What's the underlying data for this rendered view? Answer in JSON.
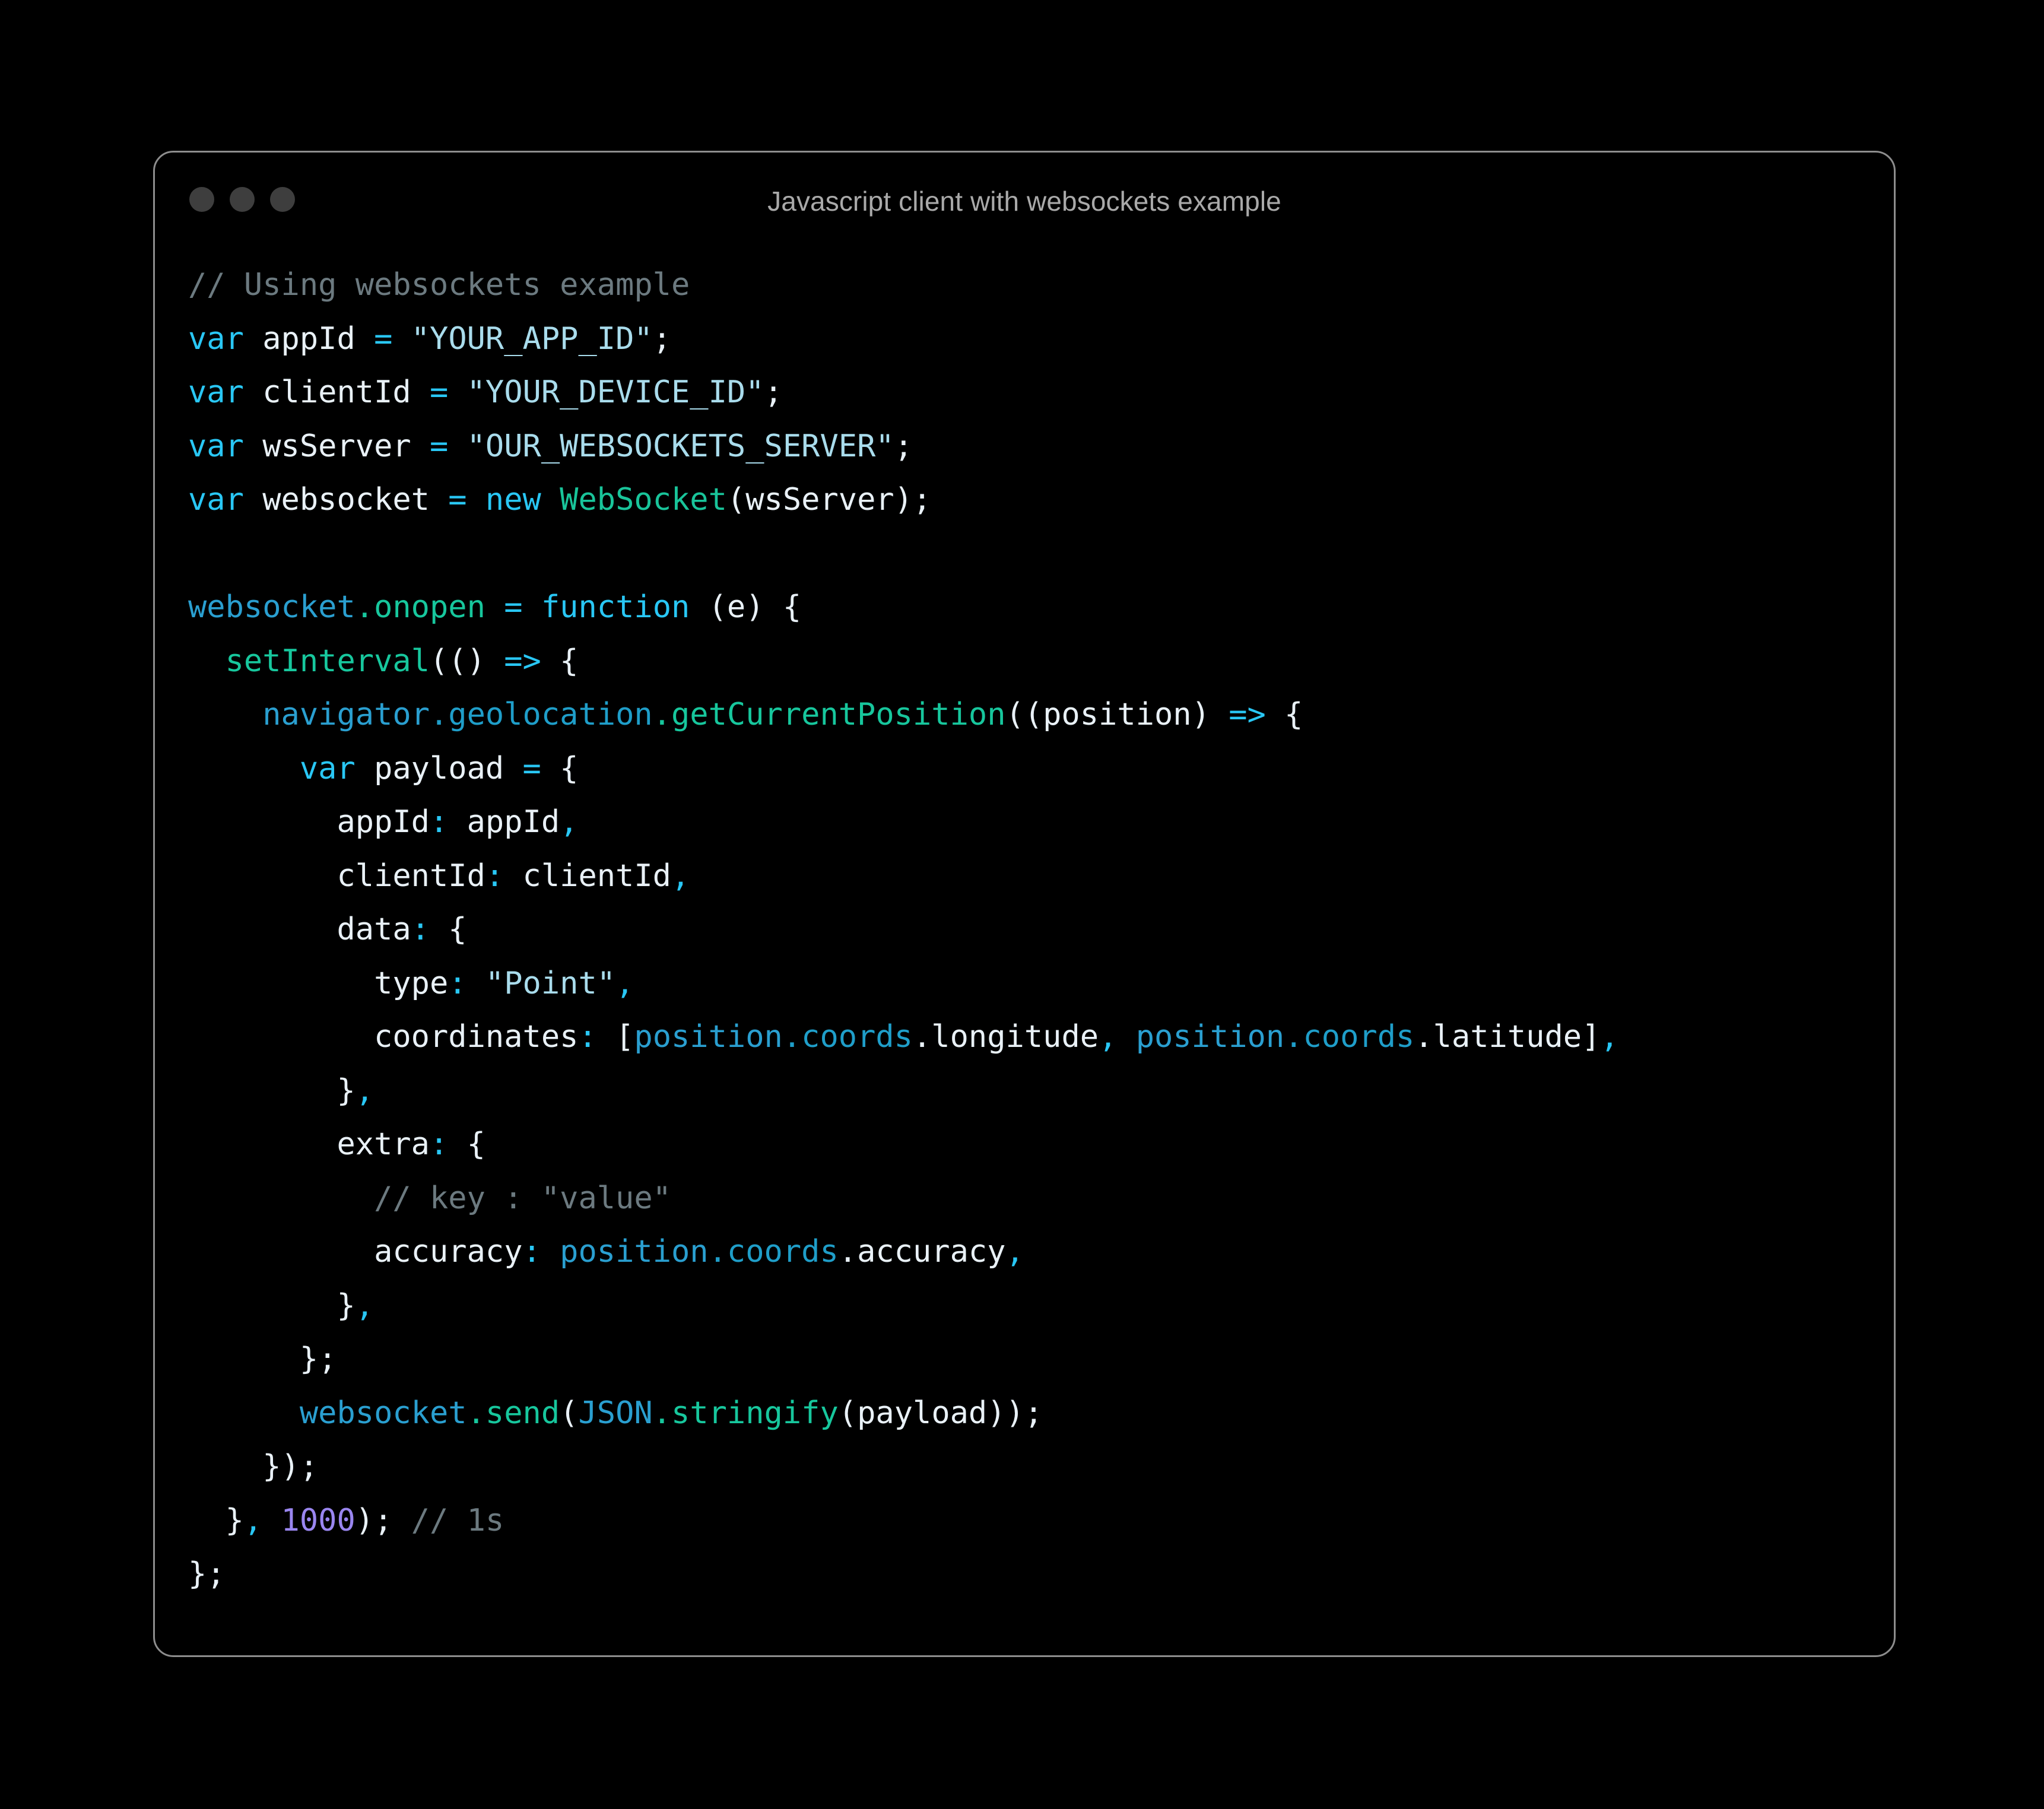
{
  "window": {
    "title": "Javascript client with websockets example",
    "traffic_lights": [
      {
        "name": "close-dot",
        "color": "#3e3e3e"
      },
      {
        "name": "minimize-dot",
        "color": "#3e3e3e"
      },
      {
        "name": "maximize-dot",
        "color": "#3e3e3e"
      }
    ],
    "border_color": "#8d8d8d",
    "background_color": "#000000"
  },
  "theme": {
    "comment": "#6c7a80",
    "keyword": "#29c7f5",
    "plain": "#e9f1f7",
    "operator": "#29c7f5",
    "string": "#a9dcec",
    "class": "#19c49a",
    "function": "#17c79d",
    "object": "#2a9fd0",
    "property": "#1f9ec9",
    "number": "#9a86f0",
    "delimiter": "#29c7f5"
  },
  "code": {
    "language": "javascript",
    "plain_text": "// Using websockets example\nvar appId = \"YOUR_APP_ID\";\nvar clientId = \"YOUR_DEVICE_ID\";\nvar wsServer = \"OUR_WEBSOCKETS_SERVER\";\nvar websocket = new WebSocket(wsServer);\n\nwebsocket.onopen = function (e) {\n  setInterval(() => {\n    navigator.geolocation.getCurrentPosition((position) => {\n      var payload = {\n        appId: appId,\n        clientId: clientId,\n        data: {\n          type: \"Point\",\n          coordinates: [position.coords.longitude, position.coords.latitude],\n        },\n        extra: {\n          // key : \"value\"\n          accuracy: position.coords.accuracy,\n        },\n      };\n      websocket.send(JSON.stringify(payload));\n    });\n  }, 1000); // 1s\n};",
    "lines": [
      [
        {
          "t": "// Using websockets example",
          "c": "comment"
        }
      ],
      [
        {
          "t": "var",
          "c": "keyword"
        },
        {
          "t": " appId ",
          "c": "plain"
        },
        {
          "t": "=",
          "c": "operator"
        },
        {
          "t": " ",
          "c": "plain"
        },
        {
          "t": "\"YOUR_APP_ID\"",
          "c": "string"
        },
        {
          "t": ";",
          "c": "plain"
        }
      ],
      [
        {
          "t": "var",
          "c": "keyword"
        },
        {
          "t": " clientId ",
          "c": "plain"
        },
        {
          "t": "=",
          "c": "operator"
        },
        {
          "t": " ",
          "c": "plain"
        },
        {
          "t": "\"YOUR_DEVICE_ID\"",
          "c": "string"
        },
        {
          "t": ";",
          "c": "plain"
        }
      ],
      [
        {
          "t": "var",
          "c": "keyword"
        },
        {
          "t": " wsServer ",
          "c": "plain"
        },
        {
          "t": "=",
          "c": "operator"
        },
        {
          "t": " ",
          "c": "plain"
        },
        {
          "t": "\"OUR_WEBSOCKETS_SERVER\"",
          "c": "string"
        },
        {
          "t": ";",
          "c": "plain"
        }
      ],
      [
        {
          "t": "var",
          "c": "keyword"
        },
        {
          "t": " websocket ",
          "c": "plain"
        },
        {
          "t": "=",
          "c": "operator"
        },
        {
          "t": " ",
          "c": "plain"
        },
        {
          "t": "new",
          "c": "keyword"
        },
        {
          "t": " ",
          "c": "plain"
        },
        {
          "t": "WebSocket",
          "c": "class"
        },
        {
          "t": "(wsServer);",
          "c": "plain"
        }
      ],
      [],
      [
        {
          "t": "websocket",
          "c": "object"
        },
        {
          "t": ".onopen",
          "c": "function"
        },
        {
          "t": " ",
          "c": "plain"
        },
        {
          "t": "=",
          "c": "operator"
        },
        {
          "t": " ",
          "c": "plain"
        },
        {
          "t": "function",
          "c": "keyword"
        },
        {
          "t": " (e) {",
          "c": "plain"
        }
      ],
      [
        {
          "t": "  ",
          "c": "plain"
        },
        {
          "t": "setInterval",
          "c": "function"
        },
        {
          "t": "(()",
          "c": "plain"
        },
        {
          "t": " ",
          "c": "plain"
        },
        {
          "t": "=>",
          "c": "operator"
        },
        {
          "t": " {",
          "c": "plain"
        }
      ],
      [
        {
          "t": "    ",
          "c": "plain"
        },
        {
          "t": "navigator",
          "c": "object"
        },
        {
          "t": ".geolocation",
          "c": "property"
        },
        {
          "t": ".getCurrentPosition",
          "c": "function"
        },
        {
          "t": "((position)",
          "c": "plain"
        },
        {
          "t": " ",
          "c": "plain"
        },
        {
          "t": "=>",
          "c": "operator"
        },
        {
          "t": " {",
          "c": "plain"
        }
      ],
      [
        {
          "t": "      ",
          "c": "plain"
        },
        {
          "t": "var",
          "c": "keyword"
        },
        {
          "t": " payload ",
          "c": "plain"
        },
        {
          "t": "=",
          "c": "operator"
        },
        {
          "t": " {",
          "c": "plain"
        }
      ],
      [
        {
          "t": "        appId",
          "c": "plain"
        },
        {
          "t": ":",
          "c": "delimiter"
        },
        {
          "t": " appId",
          "c": "plain"
        },
        {
          "t": ",",
          "c": "delimiter"
        }
      ],
      [
        {
          "t": "        clientId",
          "c": "plain"
        },
        {
          "t": ":",
          "c": "delimiter"
        },
        {
          "t": " clientId",
          "c": "plain"
        },
        {
          "t": ",",
          "c": "delimiter"
        }
      ],
      [
        {
          "t": "        data",
          "c": "plain"
        },
        {
          "t": ":",
          "c": "delimiter"
        },
        {
          "t": " {",
          "c": "plain"
        }
      ],
      [
        {
          "t": "          type",
          "c": "plain"
        },
        {
          "t": ":",
          "c": "delimiter"
        },
        {
          "t": " ",
          "c": "plain"
        },
        {
          "t": "\"Point\"",
          "c": "string"
        },
        {
          "t": ",",
          "c": "delimiter"
        }
      ],
      [
        {
          "t": "          coordinates",
          "c": "plain"
        },
        {
          "t": ":",
          "c": "delimiter"
        },
        {
          "t": " [",
          "c": "plain"
        },
        {
          "t": "position",
          "c": "object"
        },
        {
          "t": ".coords",
          "c": "property"
        },
        {
          "t": ".longitude",
          "c": "plain"
        },
        {
          "t": ",",
          "c": "delimiter"
        },
        {
          "t": " ",
          "c": "plain"
        },
        {
          "t": "position",
          "c": "object"
        },
        {
          "t": ".coords",
          "c": "property"
        },
        {
          "t": ".latitude",
          "c": "plain"
        },
        {
          "t": "]",
          "c": "plain"
        },
        {
          "t": ",",
          "c": "delimiter"
        }
      ],
      [
        {
          "t": "        }",
          "c": "plain"
        },
        {
          "t": ",",
          "c": "delimiter"
        }
      ],
      [
        {
          "t": "        extra",
          "c": "plain"
        },
        {
          "t": ":",
          "c": "delimiter"
        },
        {
          "t": " {",
          "c": "plain"
        }
      ],
      [
        {
          "t": "          // key : \"value\"",
          "c": "comment"
        }
      ],
      [
        {
          "t": "          accuracy",
          "c": "plain"
        },
        {
          "t": ":",
          "c": "delimiter"
        },
        {
          "t": " ",
          "c": "plain"
        },
        {
          "t": "position",
          "c": "object"
        },
        {
          "t": ".coords",
          "c": "property"
        },
        {
          "t": ".accuracy",
          "c": "plain"
        },
        {
          "t": ",",
          "c": "delimiter"
        }
      ],
      [
        {
          "t": "        }",
          "c": "plain"
        },
        {
          "t": ",",
          "c": "delimiter"
        }
      ],
      [
        {
          "t": "      };",
          "c": "plain"
        }
      ],
      [
        {
          "t": "      ",
          "c": "plain"
        },
        {
          "t": "websocket",
          "c": "object"
        },
        {
          "t": ".send",
          "c": "function"
        },
        {
          "t": "(",
          "c": "plain"
        },
        {
          "t": "JSON",
          "c": "object"
        },
        {
          "t": ".stringify",
          "c": "function"
        },
        {
          "t": "(payload));",
          "c": "plain"
        }
      ],
      [
        {
          "t": "    });",
          "c": "plain"
        }
      ],
      [
        {
          "t": "  }",
          "c": "plain"
        },
        {
          "t": ",",
          "c": "delimiter"
        },
        {
          "t": " ",
          "c": "plain"
        },
        {
          "t": "1000",
          "c": "number"
        },
        {
          "t": ");",
          "c": "plain"
        },
        {
          "t": " ",
          "c": "plain"
        },
        {
          "t": "// 1s",
          "c": "comment"
        }
      ],
      [
        {
          "t": "};",
          "c": "plain"
        }
      ]
    ]
  }
}
